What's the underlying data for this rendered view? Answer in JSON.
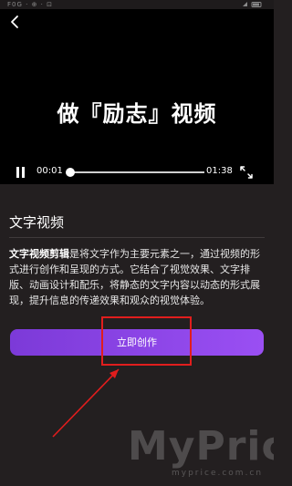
{
  "status_bar": {
    "left_text": "F0G · ⊕ · ⊡"
  },
  "video": {
    "title": "做『励志』视频",
    "current_time": "00:01",
    "total_time": "01:38",
    "progress": 0.01
  },
  "section": {
    "title": "文字视频"
  },
  "description": {
    "bold_term": "文字视频剪辑",
    "text": "是将文字作为主要元素之一，通过视频的形式进行创作和呈现的方式。它结合了视觉效果、文字排版、动画设计和配乐，将静态的文字内容以动态的形式展现，提升信息的传递效果和观众的视觉体验。"
  },
  "cta": {
    "label": "立即创作"
  },
  "watermark": {
    "brand": "MyPrice",
    "url": "myprice.com.cn"
  },
  "colors": {
    "background": "#231f20",
    "button_gradient_start": "#7c3ad8",
    "button_gradient_end": "#9a4ff3",
    "highlight": "#e11d1d"
  }
}
